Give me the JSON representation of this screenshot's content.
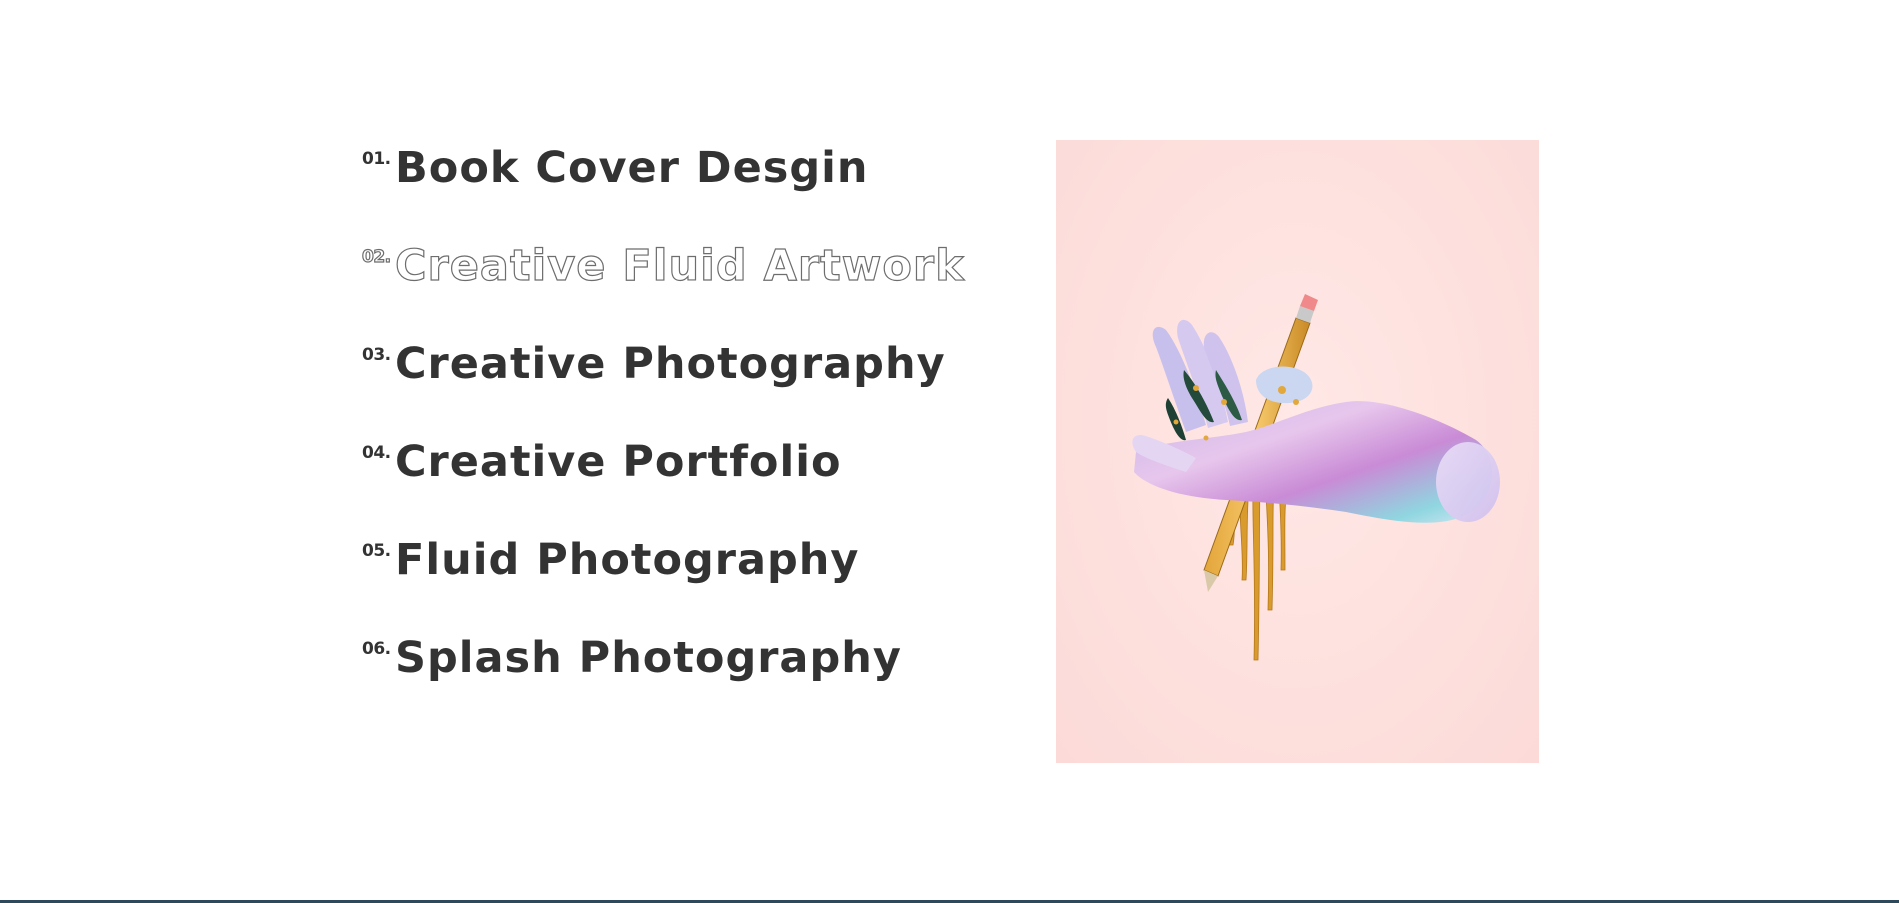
{
  "projects": [
    {
      "number": "01.",
      "title": "Book Cover Desgin",
      "active": false
    },
    {
      "number": "02.",
      "title": "Creative Fluid Artwork",
      "active": true
    },
    {
      "number": "03.",
      "title": "Creative Photography",
      "active": false
    },
    {
      "number": "04.",
      "title": "Creative Portfolio",
      "active": false
    },
    {
      "number": "05.",
      "title": "Fluid Photography",
      "active": false
    },
    {
      "number": "06.",
      "title": "Splash Photography",
      "active": false
    }
  ],
  "preview": {
    "image_subject": "holographic-hand-with-pencil",
    "background_color": "#fde0dd"
  },
  "colors": {
    "text": "#333333",
    "outline": "#6d6d6d",
    "footer_bar": "#2e4a5a"
  }
}
